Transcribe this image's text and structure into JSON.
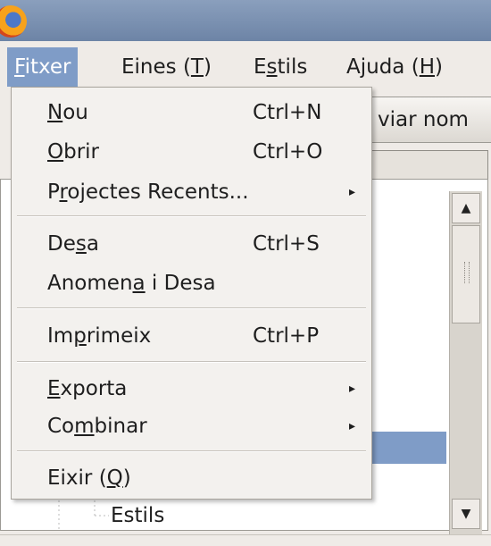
{
  "menubar": {
    "items": [
      {
        "label": "Fitxer",
        "pre": "",
        "mn": "F",
        "post": "itxer",
        "active": true
      },
      {
        "label": "Eines (T)",
        "pre": "Eines (",
        "mn": "T",
        "post": ")"
      },
      {
        "label": "Estils",
        "pre": "E",
        "mn": "s",
        "post": "tils"
      },
      {
        "label": "Ajuda (H)",
        "pre": "Ajuda (",
        "mn": "H",
        "post": ")"
      }
    ]
  },
  "background": {
    "button_label": "viar nom",
    "tree_label": "Estils"
  },
  "menu": {
    "items": [
      {
        "pre": "",
        "mn": "N",
        "post": "ou",
        "shortcut": "Ctrl+N"
      },
      {
        "pre": "",
        "mn": "O",
        "post": "brir",
        "shortcut": "Ctrl+O"
      },
      {
        "pre": "P",
        "mn": "r",
        "post": "ojectes Recents...",
        "submenu": true
      },
      {
        "pre": "De",
        "mn": "s",
        "post": "a",
        "shortcut": "Ctrl+S"
      },
      {
        "pre": "Anomen",
        "mn": "a",
        "post": " i Desa"
      },
      {
        "pre": "Im",
        "mn": "p",
        "post": "rimeix",
        "shortcut": "Ctrl+P"
      },
      {
        "pre": "",
        "mn": "E",
        "post": "xporta",
        "submenu": true
      },
      {
        "pre": "Co",
        "mn": "m",
        "post": "binar",
        "submenu": true
      },
      {
        "pre": "Eixir (",
        "mn": "Q",
        "post": ")"
      }
    ],
    "submenu_arrow": "▸"
  },
  "scrollbar": {
    "up_arrow": "▲",
    "down_arrow": "▼"
  },
  "icons": {
    "app": "firefox-logo-icon"
  },
  "colors": {
    "accent": "#7f9cc7",
    "titlebar": "#7a90b2"
  }
}
